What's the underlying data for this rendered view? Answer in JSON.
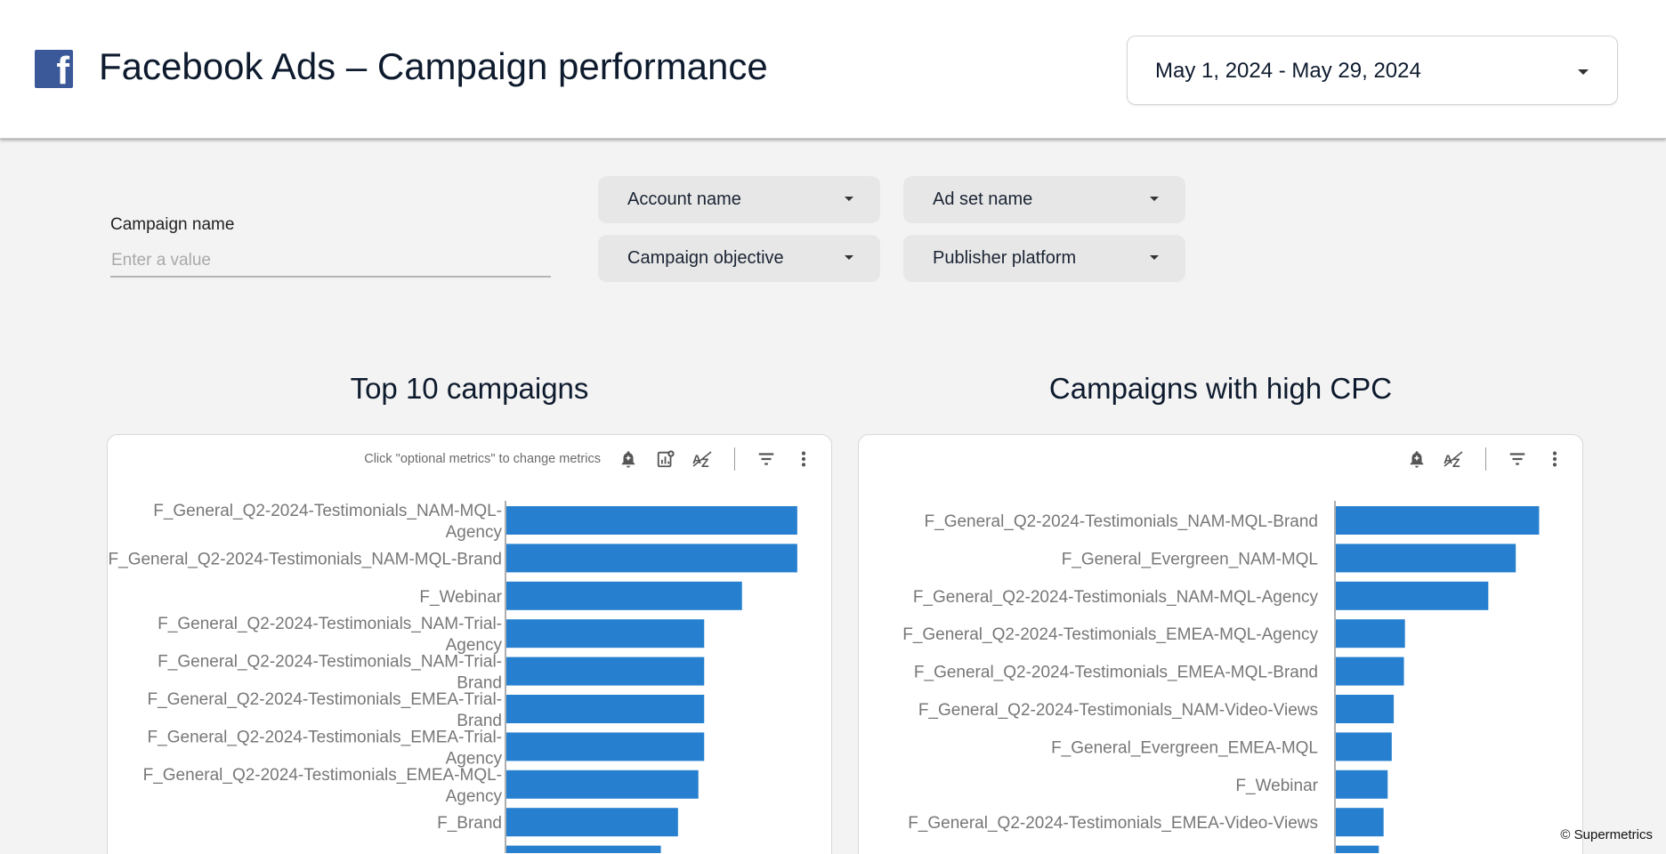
{
  "header": {
    "logo_glyph": "f",
    "logo_icon": "facebook-logo-icon",
    "title": "Facebook Ads – Campaign performance",
    "date_range": "May 1, 2024 - May 29, 2024"
  },
  "filters": {
    "campaign_name_label": "Campaign name",
    "campaign_name_placeholder": "Enter a value",
    "account_name": "Account name",
    "ad_set_name": "Ad set name",
    "campaign_objective": "Campaign objective",
    "publisher_platform": "Publisher platform"
  },
  "left_panel": {
    "title": "Top 10 campaigns",
    "hint": "Click \"optional metrics\" to change metrics",
    "icons": [
      "alert-bell-icon",
      "optional-metrics-icon",
      "sort-az-icon",
      "filter-icon",
      "more-vert-icon"
    ]
  },
  "right_panel": {
    "title": "Campaigns with high CPC",
    "icons": [
      "alert-bell-icon",
      "sort-az-icon",
      "filter-icon",
      "more-vert-icon"
    ]
  },
  "colors": {
    "bar": "#2680cf",
    "facebook": "#3b5998"
  },
  "chart_data": [
    {
      "type": "bar",
      "orientation": "horizontal",
      "title": "Top 10 campaigns",
      "categories": [
        "F_General_Q2-2024-Testimonials_NAM-MQL-Agency",
        "F_General_Q2-2024-Testimonials_NAM-MQL-Brand",
        "F_Webinar",
        "F_General_Q2-2024-Testimonials_NAM-Trial-Agency",
        "F_General_Q2-2024-Testimonials_NAM-Trial-Brand",
        "F_General_Q2-2024-Testimonials_EMEA-Trial-Brand",
        "F_General_Q2-2024-Testimonials_EMEA-Trial-Agency",
        "F_General_Q2-2024-Testimonials_EMEA-MQL-Agency",
        "F_Brand"
      ],
      "values": [
        100,
        100,
        81,
        68,
        68,
        68,
        68,
        66,
        59
      ],
      "xlim": [
        0,
        108
      ]
    },
    {
      "type": "bar",
      "orientation": "horizontal",
      "title": "Campaigns with high CPC",
      "categories": [
        "F_General_Q2-2024-Testimonials_NAM-MQL-Brand",
        "F_General_Evergreen_NAM-MQL",
        "F_General_Q2-2024-Testimonials_NAM-MQL-Agency",
        "F_General_Q2-2024-Testimonials_EMEA-MQL-Agency",
        "F_General_Q2-2024-Testimonials_EMEA-MQL-Brand",
        "F_General_Q2-2024-Testimonials_NAM-Video-Views",
        "F_General_Evergreen_EMEA-MQL",
        "F_Webinar",
        "F_General_Q2-2024-Testimonials_EMEA-Video-Views"
      ],
      "values": [
        100,
        88.5,
        75,
        34,
        33.5,
        28.5,
        27.5,
        25.5,
        23.5
      ],
      "xlim": [
        0,
        116
      ]
    }
  ],
  "footer": {
    "copyright": "© Supermetrics"
  }
}
